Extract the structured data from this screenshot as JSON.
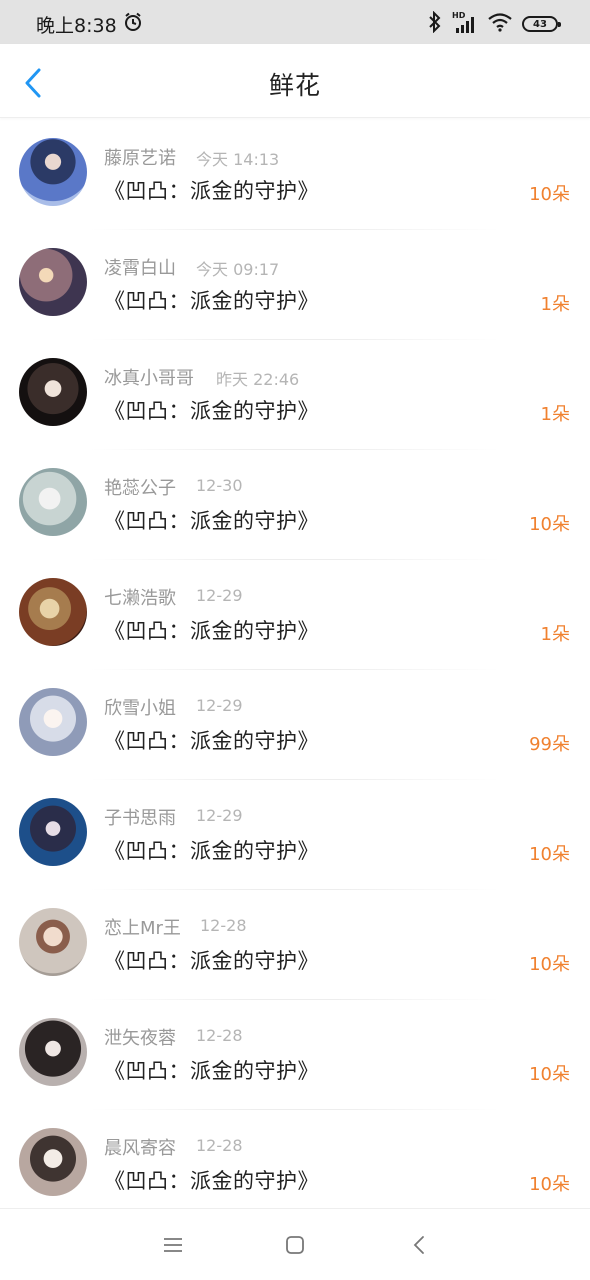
{
  "status_bar": {
    "time": "晚上8:38",
    "hd_label": "HD",
    "battery": "43"
  },
  "header": {
    "title": "鲜花"
  },
  "colors": {
    "accent_blue": "#2196f3",
    "count_orange": "#f0812f"
  },
  "records": [
    {
      "name": "藤原艺诺",
      "time": "今天 14:13",
      "book": "《凹凸：派金的守护》",
      "count": "10朵"
    },
    {
      "name": "凌霄白山",
      "time": "今天 09:17",
      "book": "《凹凸：派金的守护》",
      "count": "1朵"
    },
    {
      "name": "冰真小哥哥",
      "time": "昨天 22:46",
      "book": "《凹凸：派金的守护》",
      "count": "1朵"
    },
    {
      "name": "艳蕊公子",
      "time": "12-30",
      "book": "《凹凸：派金的守护》",
      "count": "10朵"
    },
    {
      "name": "七濑浩歌",
      "time": "12-29",
      "book": "《凹凸：派金的守护》",
      "count": "1朵"
    },
    {
      "name": "欣雪小姐",
      "time": "12-29",
      "book": "《凹凸：派金的守护》",
      "count": "99朵"
    },
    {
      "name": "子书思雨",
      "time": "12-29",
      "book": "《凹凸：派金的守护》",
      "count": "10朵"
    },
    {
      "name": "恋上Mr王",
      "time": "12-28",
      "book": "《凹凸：派金的守护》",
      "count": "10朵"
    },
    {
      "name": "泄矢夜蓉",
      "time": "12-28",
      "book": "《凹凸：派金的守护》",
      "count": "10朵"
    },
    {
      "name": "晨风寄容",
      "time": "12-28",
      "book": "《凹凸：派金的守护》",
      "count": "10朵"
    }
  ],
  "nav": {
    "icons": [
      "menu-icon",
      "home-icon",
      "back-icon"
    ]
  }
}
